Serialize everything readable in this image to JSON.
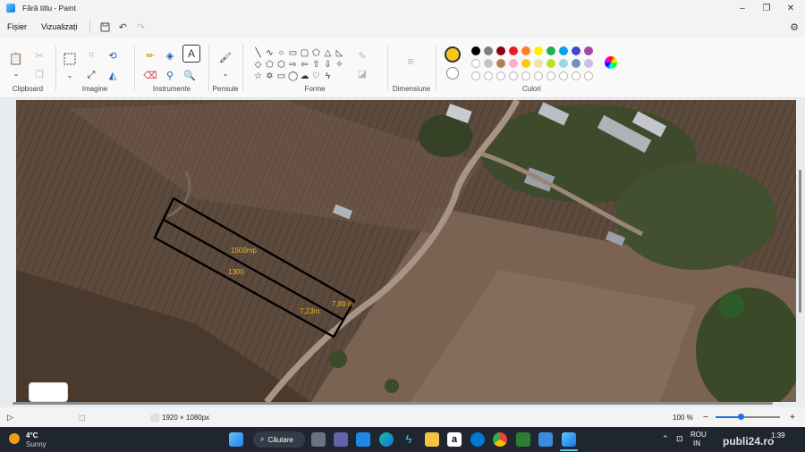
{
  "window": {
    "title": "Fără titlu - Paint",
    "minimize": "–",
    "maximize": "❐",
    "close": "✕"
  },
  "menu": {
    "file": "Fișier",
    "view": "Vizualizați",
    "save_icon": "save-icon",
    "undo_icon": "undo-icon",
    "redo_icon": "redo-icon"
  },
  "ribbon": {
    "groups": {
      "clipboard": "Clipboard",
      "image": "Imagine",
      "tools": "Instrumente",
      "brushes": "Pensule",
      "shapes": "Forme",
      "size": "Dimensiune",
      "colors": "Culori"
    },
    "text_tool": "A",
    "colors": {
      "primary": "#f5c518",
      "secondary": "#ffffff",
      "row1": [
        "#000000",
        "#7f7f7f",
        "#880015",
        "#ed1c24",
        "#ff7f27",
        "#fff200",
        "#22b14c",
        "#00a2e8",
        "#3f48cc",
        "#a349a4"
      ],
      "row2": [
        "#ffffff",
        "#c3c3c3",
        "#b97a57",
        "#ffaec9",
        "#ffc90e",
        "#efe4b0",
        "#b5e61d",
        "#99d9ea",
        "#7092be",
        "#c8bfe7"
      ]
    }
  },
  "canvas": {
    "annotations": {
      "area": "1500mp",
      "length": "1300",
      "width_bottom": "7,23m",
      "width_right": "7,89 m"
    },
    "annotation_color": "#e8b820"
  },
  "status": {
    "dimensions": "1920 × 1080px",
    "zoom": "100 %",
    "zoom_out": "−",
    "zoom_in": "+"
  },
  "taskbar": {
    "weather_temp": "4°C",
    "weather_desc": "Sunny",
    "search_label": "Căutare",
    "lang_top": "ROU",
    "lang_bottom": "IN",
    "clock": "1:39",
    "watermark": "publi24.ro"
  }
}
